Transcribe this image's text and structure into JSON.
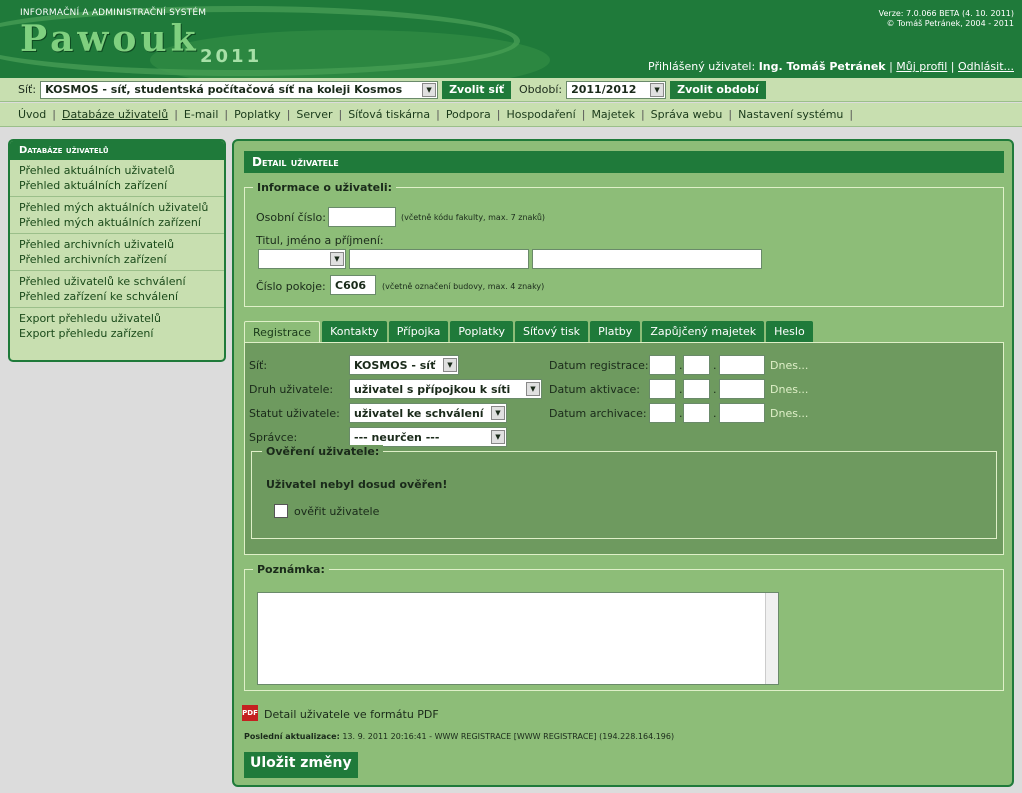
{
  "header": {
    "system_title": "INFORMAČNÍ A ADMINISTRAČNÍ SYSTÉM",
    "logo_text": "Pawouk",
    "logo_year": "2011",
    "version_line1": "Verze: 7.0.066 BETA (4. 10. 2011)",
    "version_line2": "© Tomáš Petránek, 2004 - 2011",
    "user_prefix": "Přihlášený uživatel:",
    "user_name": "Ing. Tomáš Petránek",
    "my_profile": "Můj profil",
    "logout": "Odhlásit..."
  },
  "selectbar": {
    "net_label": "Síť:",
    "net_value": "KOSMOS - síť, studentská počítačová síť na koleji Kosmos",
    "net_button": "Zvolit síť",
    "period_label": "Období:",
    "period_value": "2011/2012",
    "period_button": "Zvolit období"
  },
  "nav": {
    "items": [
      "Úvod",
      "Databáze uživatelů",
      "E-mail",
      "Poplatky",
      "Server",
      "Síťová tiskárna",
      "Podpora",
      "Hospodaření",
      "Majetek",
      "Správa webu",
      "Nastavení systému"
    ]
  },
  "sidebar": {
    "title": "Databáze uživatelů",
    "groups": [
      [
        "Přehled aktuálních uživatelů",
        "Přehled aktuálních zařízení"
      ],
      [
        "Přehled mých aktuálních uživatelů",
        "Přehled mých aktuálních zařízení"
      ],
      [
        "Přehled archivních uživatelů",
        "Přehled archivních zařízení"
      ],
      [
        "Přehled uživatelů ke schválení",
        "Přehled zařízení ke schválení"
      ],
      [
        "Export přehledu uživatelů",
        "Export přehledu zařízení"
      ]
    ]
  },
  "main": {
    "title": "Detail uživatele",
    "info_legend": "Informace o uživateli:",
    "personal_number_label": "Osobní číslo:",
    "personal_number_value": "",
    "personal_number_hint": "(včetně kódu fakulty, max. 7 znaků)",
    "name_label": "Titul, jméno a příjmení:",
    "title_value": "",
    "first_name_value": "",
    "last_name_value": "",
    "room_label": "Číslo pokoje:",
    "room_value": "C606",
    "room_hint": "(včetně označení budovy, max. 4 znaky)",
    "tabs": [
      "Registrace",
      "Kontakty",
      "Přípojka",
      "Poplatky",
      "Síťový tisk",
      "Platby",
      "Zapůjčený majetek",
      "Heslo"
    ],
    "reg": {
      "net_label": "Síť:",
      "net_value": "KOSMOS - síť",
      "type_label": "Druh uživatele:",
      "type_value": "uživatel s přípojkou k síti",
      "status_label": "Statut uživatele:",
      "status_value": "uživatel ke schválení",
      "admin_label": "Správce:",
      "admin_value": "--- neurčen ---",
      "date_reg_label": "Datum registrace:",
      "date_act_label": "Datum aktivace:",
      "date_arch_label": "Datum archivace:",
      "today": "Dnes...",
      "verify_legend": "Ověření uživatele:",
      "verify_status": "Uživatel nebyl dosud ověřen!",
      "verify_checkbox": "ověřit uživatele"
    },
    "note_legend": "Poznámka:",
    "note_value": "",
    "pdf_icon": "PDF",
    "pdf_link": "Detail uživatele ve formátu PDF",
    "last_update_label": "Poslední aktualizace:",
    "last_update_value": "13. 9. 2011  20:16:41 - WWW REGISTRACE [WWW REGISTRACE] (194.228.164.196)",
    "save_button": "Uložit změny"
  },
  "colors": {
    "accent": "#1f7a3a",
    "panel": "#8dbd78",
    "nav": "#c8dfb0"
  }
}
